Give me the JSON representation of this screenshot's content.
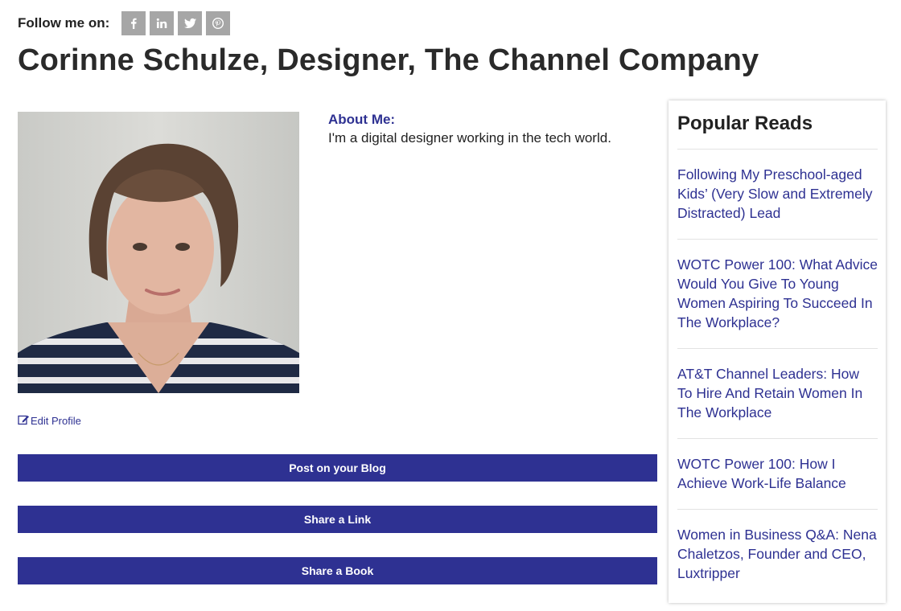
{
  "header": {
    "follow_label": "Follow me on:",
    "social": [
      {
        "icon": "facebook-icon",
        "glyph": "f"
      },
      {
        "icon": "linkedin-icon",
        "glyph": "in"
      },
      {
        "icon": "twitter-icon",
        "glyph": "twitter bird"
      },
      {
        "icon": "pinterest-icon",
        "glyph": "p"
      }
    ],
    "title": "Corinne Schulze, Designer, The Channel Company"
  },
  "profile": {
    "photo_alt": "Profile photo",
    "about_label": "About Me:",
    "about_text": "I'm a digital designer working in the tech world.",
    "edit_label": "Edit Profile"
  },
  "actions": {
    "post_blog": "Post on your Blog",
    "share_link": "Share a Link",
    "share_book": "Share a Book"
  },
  "sidebar": {
    "title": "Popular Reads",
    "items": [
      {
        "label": "Following My Preschool-aged Kids’ (Very Slow and Extremely Distracted) Lead"
      },
      {
        "label": "WOTC Power 100: What Advice Would You Give To Young Women Aspiring To Succeed In The Workplace?"
      },
      {
        "label": "AT&T Channel Leaders: How To Hire And Retain Women In The Workplace"
      },
      {
        "label": "WOTC Power 100: How I Achieve Work-Life Balance"
      },
      {
        "label": "Women in Business Q&A: Nena Chaletzos, Founder and CEO, Luxtripper"
      }
    ]
  },
  "colors": {
    "accent": "#2e3192",
    "social_bg": "#a6a6a6",
    "title_text": "#2a2a2a"
  }
}
